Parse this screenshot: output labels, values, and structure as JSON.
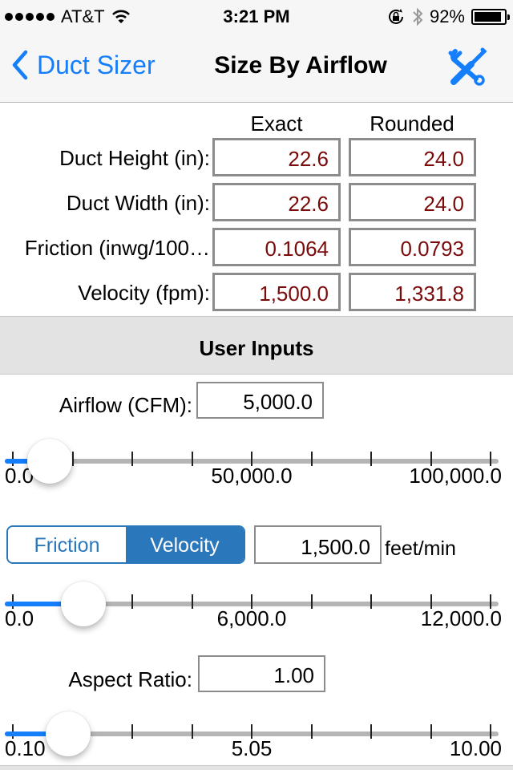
{
  "status_bar": {
    "signal_dots": 5,
    "carrier": "AT&T",
    "time": "3:21 PM",
    "battery_percent": "92%",
    "battery_level": 0.92,
    "icons": [
      "signal-dots-icon",
      "wifi-icon",
      "rotation-lock-icon",
      "bluetooth-icon",
      "battery-icon"
    ]
  },
  "nav": {
    "back_label": "Duct Sizer",
    "title": "Size By Airflow",
    "right_icon": "tools-icon"
  },
  "results": {
    "col_exact": "Exact",
    "col_rounded": "Rounded",
    "rows": [
      {
        "label": "Duct Height (in):",
        "exact": "22.6",
        "rounded": "24.0"
      },
      {
        "label": "Duct Width (in):",
        "exact": "22.6",
        "rounded": "24.0"
      },
      {
        "label": "Friction (inwg/100…",
        "exact": "0.1064",
        "rounded": "0.0793"
      },
      {
        "label": "Velocity (fpm):",
        "exact": "1,500.0",
        "rounded": "1,331.8"
      }
    ],
    "value_color": "#7a0b0b"
  },
  "user_inputs": {
    "header": "User Inputs",
    "airflow": {
      "label": "Airflow (CFM):",
      "value": "5,000.0",
      "slider": {
        "min": 0,
        "max": 100000,
        "value": 5000,
        "labels": [
          "0.0",
          "50,000.0",
          "100,000.0"
        ]
      }
    },
    "mode": {
      "options": [
        "Friction",
        "Velocity"
      ],
      "selected": "Velocity",
      "value": "1,500.0",
      "unit": "feet/min",
      "slider": {
        "min": 0,
        "max": 12000,
        "value": 1500,
        "labels": [
          "0.0",
          "6,000.0",
          "12,000.0"
        ]
      }
    },
    "aspect": {
      "label": "Aspect Ratio:",
      "value": "1.00",
      "slider": {
        "min": 0.1,
        "max": 10.0,
        "value": 1.0,
        "labels": [
          "0.10",
          "5.05",
          "10.00"
        ]
      }
    }
  },
  "colors": {
    "accent": "#157efb",
    "segment": "#2a77bb",
    "track": "#b5b5b5",
    "section_bg": "#e3e3e3"
  }
}
